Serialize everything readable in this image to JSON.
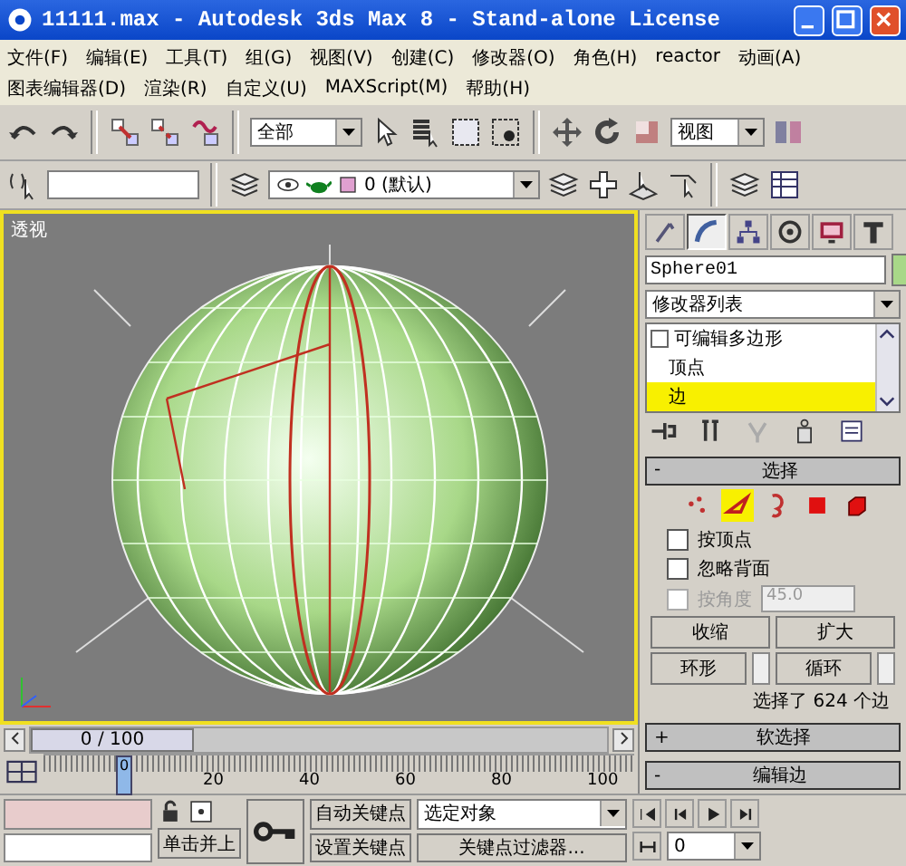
{
  "window": {
    "title": "11111.max - Autodesk 3ds Max 8  - Stand-alone License"
  },
  "menu_rows": [
    [
      "文件(F)",
      "编辑(E)",
      "工具(T)",
      "组(G)",
      "视图(V)",
      "创建(C)",
      "修改器(O)",
      "角色(H)",
      "reactor",
      "动画(A)"
    ],
    [
      "图表编辑器(D)",
      "渲染(R)",
      "自定义(U)",
      "MAXScript(M)",
      "帮助(H)"
    ]
  ],
  "toolbar": {
    "selection_filter": "全部",
    "reference_coordinate": "视图",
    "layer": "0 (默认)"
  },
  "viewport": {
    "label": "透视"
  },
  "command_panel": {
    "tabs": [
      {
        "selected": false
      },
      {
        "selected": true
      },
      {
        "selected": false
      },
      {
        "selected": false
      },
      {
        "selected": false
      },
      {
        "selected": false
      }
    ],
    "object_name": "Sphere01",
    "modifier_list": "修改器列表",
    "stack": [
      {
        "label": "可编辑多边形",
        "expanded": true,
        "selected": false,
        "children": [
          {
            "label": "顶点",
            "selected": false
          },
          {
            "label": "边",
            "selected": true
          }
        ]
      }
    ],
    "selection_rollout": {
      "title": "选择",
      "sign": "-",
      "subobjects": [
        {
          "kind": "vertex",
          "selected": false
        },
        {
          "kind": "edge",
          "selected": true
        },
        {
          "kind": "border",
          "selected": false
        },
        {
          "kind": "polygon",
          "selected": false
        },
        {
          "kind": "element",
          "selected": false
        }
      ],
      "checkboxes": [
        {
          "label": "按顶点",
          "checked": false,
          "disabled": false
        },
        {
          "label": "忽略背面",
          "checked": false,
          "disabled": false
        },
        {
          "label": "按角度",
          "checked": false,
          "disabled": true,
          "value": "45.0"
        }
      ],
      "buttons": [
        "收缩",
        "扩大"
      ],
      "spinner_buttons": [
        "环形",
        "循环"
      ],
      "status": "选择了 624 个边"
    },
    "collapsed_rollouts": [
      {
        "title": "软选择",
        "sign": "+"
      },
      {
        "title": "编辑边",
        "sign": "-"
      }
    ]
  },
  "time_slider": {
    "reading": "0 / 100",
    "level": 0
  },
  "track_bar": {
    "labels": [
      "20",
      "40",
      "60",
      "80",
      "100"
    ],
    "current": "0"
  },
  "bottom": {
    "script_fields": [
      {
        "color": "#e8cccc"
      },
      {
        "color": "#ffffff"
      }
    ],
    "click_button": "单击并上",
    "auto_key": "自动关键点",
    "set_key": "设置关键点",
    "key_mode": "选定对象",
    "key_filters": "关键点过滤器...",
    "frame": "0"
  }
}
